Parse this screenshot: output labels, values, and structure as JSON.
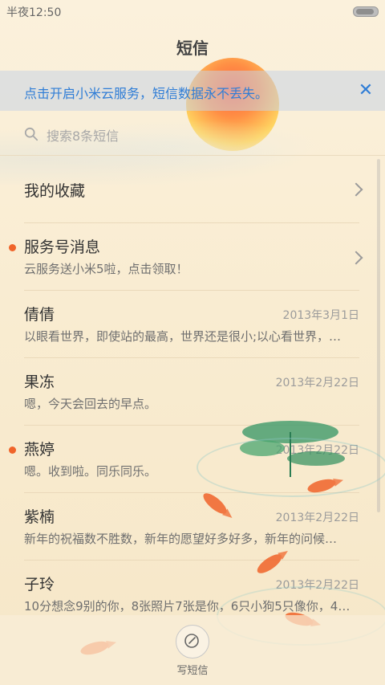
{
  "status_bar": {
    "time": "半夜12:50"
  },
  "header": {
    "title": "短信"
  },
  "banner": {
    "text": "点击开启小米云服务，短信数据永不丢失。",
    "close_icon": "close-icon",
    "accent": "#2f7dd6"
  },
  "search": {
    "placeholder": "搜索8条短信",
    "icon": "search-icon"
  },
  "favorites": {
    "label": "我的收藏"
  },
  "threads": [
    {
      "name": "服务号消息",
      "preview": "云服务送小米5啦，点击领取！",
      "date": "",
      "unread": true
    },
    {
      "name": "倩倩",
      "preview": "以眼看世界，即使站的最高，世界还是很小;以心看世界，…",
      "date": "2013年3月1日",
      "unread": false
    },
    {
      "name": "果冻",
      "preview": "嗯，今天会回去的早点。",
      "date": "2013年2月22日",
      "unread": false
    },
    {
      "name": "燕婷",
      "preview": "嗯。收到啦。同乐同乐。",
      "date": "2013年2月22日",
      "unread": true
    },
    {
      "name": "紫楠",
      "preview": "新年的祝福数不胜数，新年的愿望好多好多，新年的问候…",
      "date": "2013年2月22日",
      "unread": false
    },
    {
      "name": "子玲",
      "preview": "10分想念9别的你，8张照片7张是你，6只小狗5只像你，4…",
      "date": "2013年2月22日",
      "unread": false
    }
  ],
  "compose": {
    "label": "写短信",
    "icon": "compose-icon"
  },
  "colors": {
    "unread_dot": "#f0642a",
    "background": "#fbf1dc"
  }
}
